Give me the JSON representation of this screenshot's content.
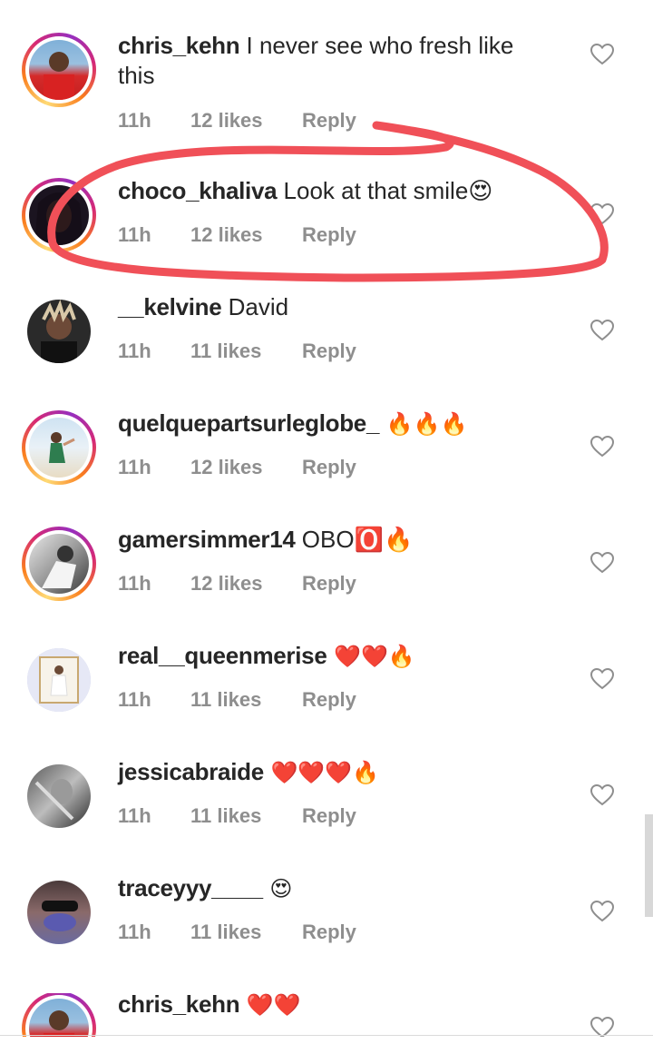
{
  "comments": [
    {
      "username": "chris_kehn",
      "text": " I never see who fresh like this",
      "time": "11h",
      "likes": "12 likes",
      "reply": "Reply"
    },
    {
      "username": "choco_khaliva",
      "text": " Look at that smile😍",
      "time": "11h",
      "likes": "12 likes",
      "reply": "Reply"
    },
    {
      "username": "__kelvine",
      "text": " David",
      "time": "11h",
      "likes": "11 likes",
      "reply": "Reply"
    },
    {
      "username": "quelquepartsurleglobe_",
      "text": " 🔥🔥🔥",
      "time": "11h",
      "likes": "12 likes",
      "reply": "Reply"
    },
    {
      "username": "gamersimmer14",
      "text": " OBO🅾️🔥",
      "time": "11h",
      "likes": "12 likes",
      "reply": "Reply"
    },
    {
      "username": "real__queenmerise",
      "text": " ❤️❤️🔥",
      "time": "11h",
      "likes": "11 likes",
      "reply": "Reply"
    },
    {
      "username": "jessicabraide",
      "text": " ❤️❤️❤️🔥",
      "time": "11h",
      "likes": "11 likes",
      "reply": "Reply"
    },
    {
      "username": "traceyyy____",
      "text": " 😍",
      "time": "11h",
      "likes": "11 likes",
      "reply": "Reply"
    },
    {
      "username": "chris_kehn",
      "text": " ❤️❤️",
      "time": "",
      "likes": "",
      "reply": ""
    }
  ],
  "icons": {
    "like": "heart-outline-icon"
  },
  "colors": {
    "meta": "#8e8e8e",
    "annotation": "#f05058",
    "story_ring": "#d62976"
  }
}
